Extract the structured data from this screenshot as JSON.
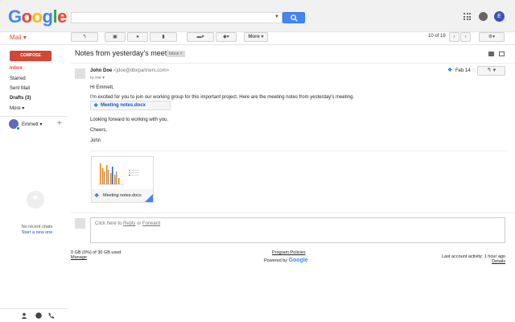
{
  "app": {
    "logo": "Google",
    "product_label": "Mail ▾"
  },
  "search": {
    "placeholder": ""
  },
  "toolbar": {
    "more_label": "More ▾",
    "pager": "10 of 19"
  },
  "sidebar": {
    "compose_label": "COMPOSE",
    "items": [
      {
        "label": "Inbox"
      },
      {
        "label": "Starred"
      },
      {
        "label": "Sent Mail"
      },
      {
        "label": "Drafts (3)"
      },
      {
        "label": "More ▾"
      }
    ],
    "chat_user": "Emmett ▾",
    "no_chats": "No recent chats",
    "start_new": "Start a new one"
  },
  "message": {
    "subject": "Notes from yesterday's meeting",
    "label": "Inbox ×",
    "sender_name": "John Doe",
    "sender_email": "<jdoe@dbxpartners.com>",
    "to": "to me ▾",
    "date": "Feb 14",
    "greeting": "Hi Emmett,",
    "para1": "I'm excited for you to join our working group for this important project. Here are the meeting notes from yesterday's meeting.",
    "inline_attachment": "Meeting notes.docx",
    "para2": "Looking forward to working with you.",
    "closing": "Cheers,",
    "signature": "John",
    "attachment_name": "Meeting notes.docx"
  },
  "reply": {
    "prefix": "Click here to ",
    "reply_link": "Reply",
    "or": " or ",
    "forward_link": "Forward"
  },
  "footer": {
    "storage": "0 GB (0%) of 30 GB used",
    "manage": "Manage",
    "program_policies": "Program Policies",
    "powered_by": "Powered by",
    "powered_brand": "Google",
    "last_activity": "Last account activity: 1 hour ago",
    "details": "Details"
  },
  "colors": {
    "accent": "#dd4b39",
    "compose": "#d14836",
    "search_blue": "#4285f4",
    "dropbox": "#0061fe"
  }
}
